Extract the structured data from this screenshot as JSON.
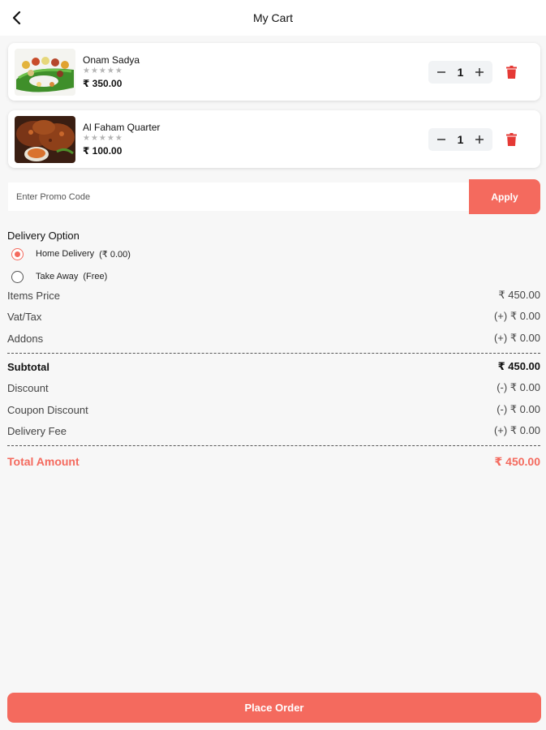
{
  "header": {
    "title": "My Cart"
  },
  "cart": {
    "items": [
      {
        "name": "Onam Sadya",
        "rating_stars": "★★★★★",
        "price": "₹ 350.00",
        "quantity": "1"
      },
      {
        "name": "Al Faham Quarter",
        "rating_stars": "★★★★★",
        "price": "₹ 100.00",
        "quantity": "1"
      }
    ]
  },
  "promo": {
    "placeholder": "Enter Promo Code",
    "value": "",
    "apply_label": "Apply"
  },
  "delivery": {
    "title": "Delivery Option",
    "options": [
      {
        "label": "Home Delivery",
        "extra": "(₹ 0.00)",
        "selected": true
      },
      {
        "label": "Take Away",
        "extra": "(Free)",
        "selected": false
      }
    ]
  },
  "summary": {
    "items_price": {
      "label": "Items Price",
      "value": "₹ 450.00"
    },
    "vat_tax": {
      "label": "Vat/Tax",
      "value": "(+) ₹ 0.00"
    },
    "addons": {
      "label": "Addons",
      "value": "(+) ₹ 0.00"
    },
    "subtotal": {
      "label": "Subtotal",
      "value": "₹ 450.00"
    },
    "discount": {
      "label": "Discount",
      "value": "(-) ₹ 0.00"
    },
    "coupon_discount": {
      "label": "Coupon Discount",
      "value": "(-) ₹ 0.00"
    },
    "delivery_fee": {
      "label": "Delivery Fee",
      "value": "(+) ₹ 0.00"
    },
    "total": {
      "label": "Total Amount",
      "value": "₹ 450.00"
    }
  },
  "footer": {
    "place_order_label": "Place Order"
  },
  "colors": {
    "accent": "#f46a5e",
    "delete": "#e53935",
    "background": "#f7f7f7"
  }
}
